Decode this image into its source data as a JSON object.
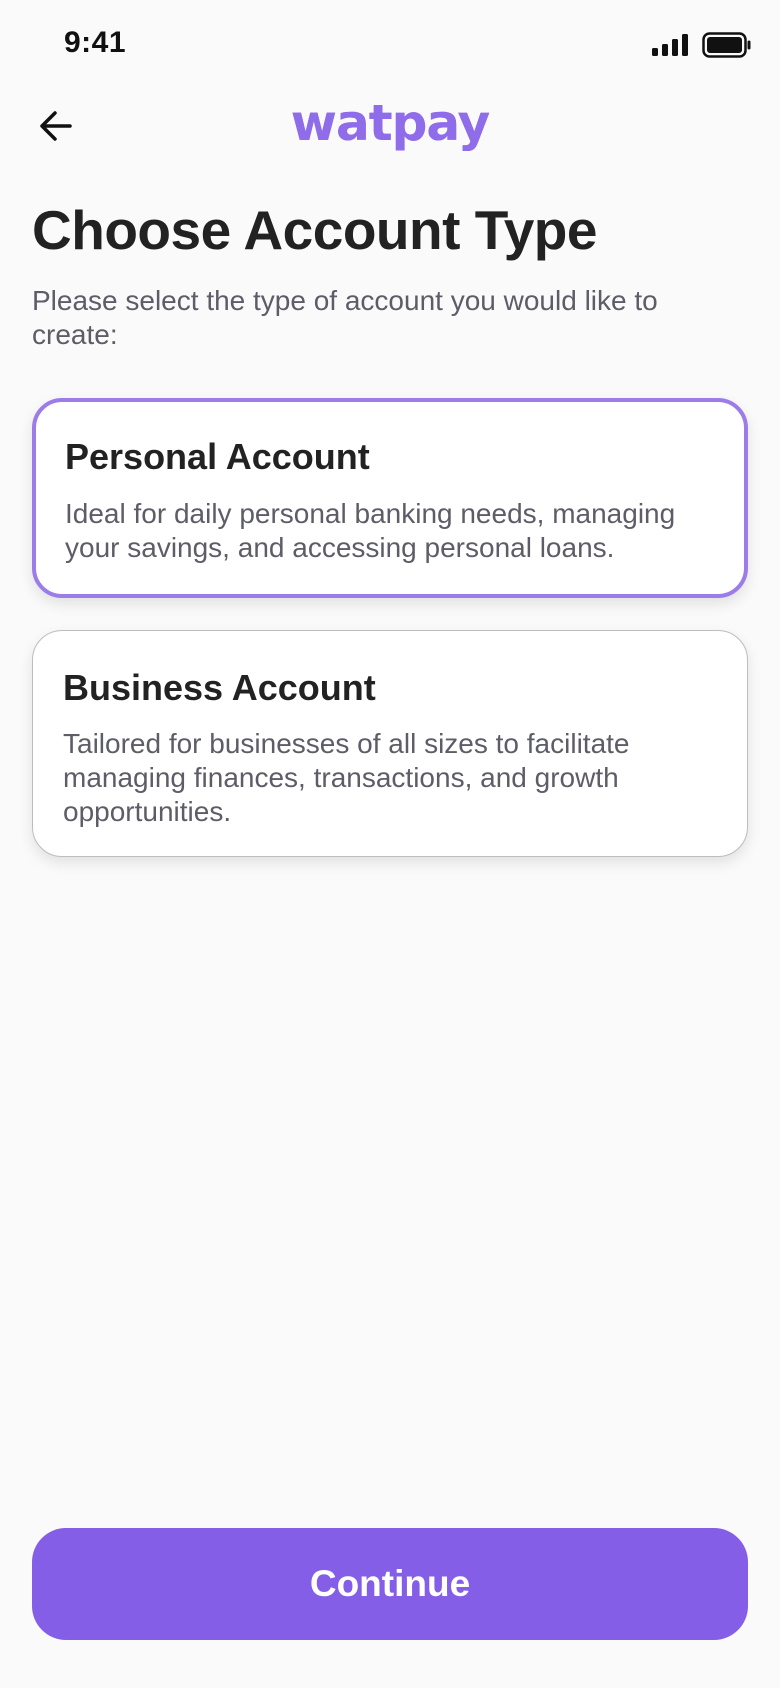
{
  "status_bar": {
    "time": "9:41",
    "signal_icon": "cellular-signal-icon",
    "battery_icon": "battery-full-icon"
  },
  "header": {
    "back_icon": "arrow-left-icon",
    "brand": "watpay",
    "brand_color": "#8f6ce9"
  },
  "page": {
    "title": "Choose Account Type",
    "subtitle": "Please select the type of account you would like to create:"
  },
  "account_options": [
    {
      "title": "Personal Account",
      "description": "Ideal for daily personal banking needs, managing your savings, and accessing personal loans.",
      "selected": true
    },
    {
      "title": "Business Account",
      "description": "Tailored for businesses of all sizes to facilitate managing finances, transactions, and growth opportunities.",
      "selected": false
    }
  ],
  "footer": {
    "continue_label": "Continue"
  },
  "colors": {
    "accent": "#845ee6",
    "selected_border": "#9b7ce9",
    "background": "#fafafa",
    "text_primary": "#222222",
    "text_secondary": "#5d5d68"
  }
}
